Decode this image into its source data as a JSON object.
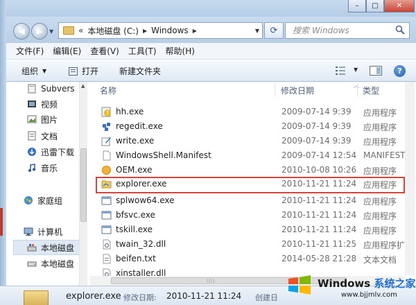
{
  "window": {
    "minimize": "–",
    "maximize": "□",
    "close": "✕"
  },
  "address": {
    "raquo": "«",
    "crumbs": [
      "本地磁盘 (C:)",
      "Windows"
    ],
    "search_placeholder": "搜索 Windows"
  },
  "menu": [
    "文件(F)",
    "编辑(E)",
    "查看(V)",
    "工具(T)",
    "帮助(H)"
  ],
  "toolbar": {
    "organize": "组织",
    "open": "打开",
    "new_folder": "新建文件夹",
    "help": "?"
  },
  "nav_pane": {
    "items": [
      "Subvers",
      "视频",
      "图片",
      "文档",
      "迅雷下载",
      "音乐",
      "家庭组",
      "计算机",
      "本地磁盘",
      "本地磁盘"
    ]
  },
  "columns": {
    "name": "名称",
    "date": "修改日期",
    "type": "类型"
  },
  "files": [
    {
      "name": "hh.exe",
      "date": "2009-07-14 9:39",
      "type": "应用程序",
      "icon": "help-icon"
    },
    {
      "name": "regedit.exe",
      "date": "2009-07-14 9:39",
      "type": "应用程序",
      "icon": "registry-icon"
    },
    {
      "name": "write.exe",
      "date": "2009-07-14 9:39",
      "type": "应用程序",
      "icon": "pen-icon"
    },
    {
      "name": "WindowsShell.Manifest",
      "date": "2009-07-14 12:54",
      "type": "MANIFEST",
      "icon": "file-icon"
    },
    {
      "name": "OEM.exe",
      "date": "2010-10-08 10:26",
      "type": "应用程序",
      "icon": "oem-icon"
    },
    {
      "name": "explorer.exe",
      "date": "2010-11-21 11:24",
      "type": "应用程序",
      "icon": "explorer-icon"
    },
    {
      "name": "splwow64.exe",
      "date": "2010-11-21 11:24",
      "type": "应用程序",
      "icon": "app-window-icon"
    },
    {
      "name": "bfsvc.exe",
      "date": "2010-11-21 11:24",
      "type": "应用程序",
      "icon": "app-window-icon"
    },
    {
      "name": "tskill.exe",
      "date": "2010-11-21 11:24",
      "type": "应用程序",
      "icon": "app-window-icon"
    },
    {
      "name": "twain_32.dll",
      "date": "2010-11-21 11:25",
      "type": "应用程序扩",
      "icon": "dll-icon"
    },
    {
      "name": "beifen.txt",
      "date": "2014-05-28 21:28",
      "type": "文本文档",
      "icon": "text-file-icon"
    },
    {
      "name": "xinstaller.dll",
      "date": "",
      "type": "",
      "icon": "dll-icon"
    }
  ],
  "details": {
    "name": "explorer.exe",
    "modified_label": "修改日期:",
    "modified_value": "2010-11-21 11:24",
    "created_label": "创建日"
  },
  "watermark": {
    "brand": "Windows",
    "brand_cn": "系统之家",
    "url": "www.bjjmlv.com"
  },
  "colors": {
    "highlight_border": "#d9443a",
    "accent": "#1f6fd1"
  }
}
